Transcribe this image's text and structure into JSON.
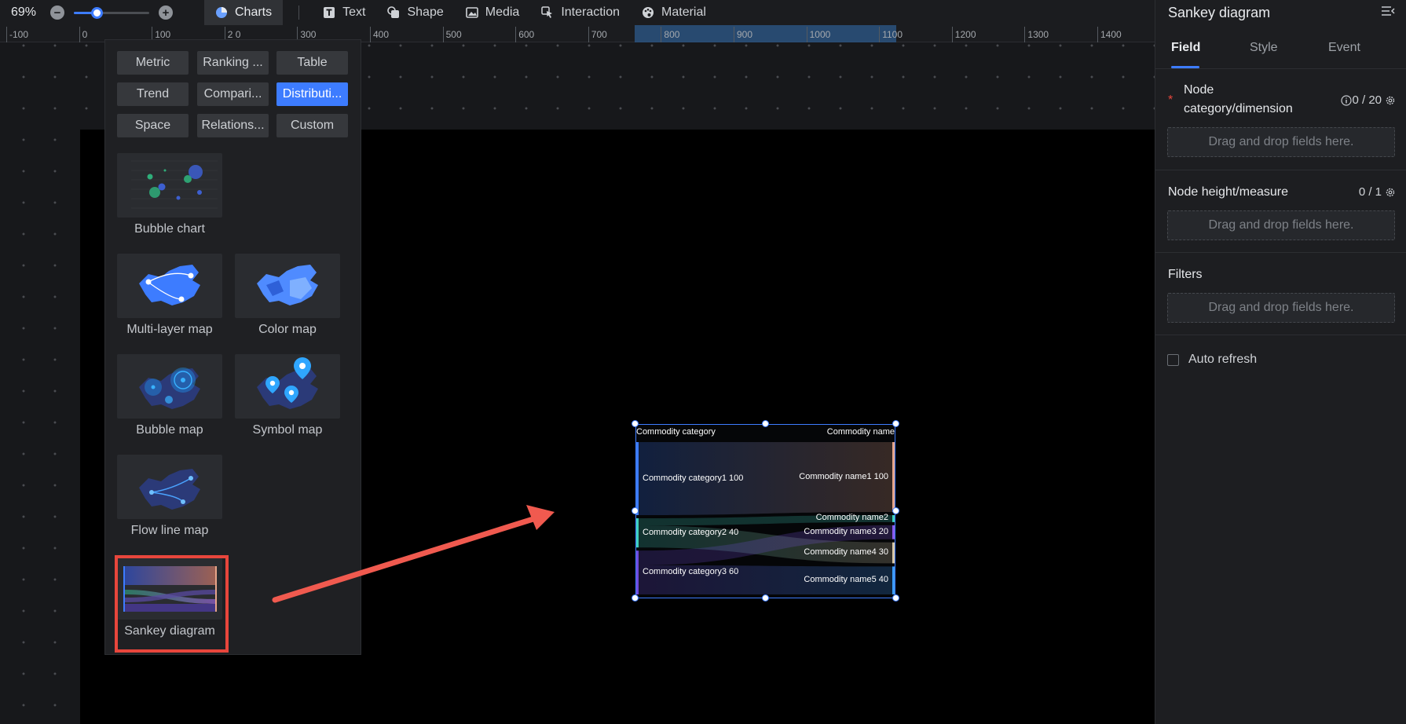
{
  "toolbar": {
    "zoom": "69%",
    "zoom_level_fraction": 0.3,
    "tools": [
      {
        "label": "Charts",
        "icon": "pie-chart-icon",
        "active": true
      },
      {
        "label": "Text",
        "icon": "text-icon"
      },
      {
        "label": "Shape",
        "icon": "shape-icon"
      },
      {
        "label": "Media",
        "icon": "image-icon"
      },
      {
        "label": "Interaction",
        "icon": "pointer-icon"
      },
      {
        "label": "Material",
        "icon": "palette-icon"
      }
    ]
  },
  "ruler": {
    "labels": [
      "-100",
      "0",
      "100",
      "2 0",
      "300",
      "400",
      "500",
      "600",
      "700",
      "800",
      "900",
      "1000",
      "1100",
      "1200",
      "1300",
      "1400"
    ]
  },
  "picker": {
    "categories": [
      "Metric",
      "Ranking ...",
      "Table",
      "Trend",
      "Compari...",
      "Distributi...",
      "Space",
      "Relations...",
      "Custom"
    ],
    "active_category": "Distributi...",
    "charts": [
      "Bubble chart",
      "Multi-layer map",
      "Color map",
      "Bubble map",
      "Symbol map",
      "Flow line map",
      "Sankey diagram"
    ],
    "selected_chart": "Sankey diagram"
  },
  "widget": {
    "left_header": "Commodity category",
    "right_header": "Commodity name",
    "left_nodes": [
      {
        "label": "Commodity category1 100",
        "value": 100,
        "color": "#3d7cff"
      },
      {
        "label": "Commodity category2 40",
        "value": 40,
        "color": "#3fd1c0"
      },
      {
        "label": "Commodity category3 60",
        "value": 60,
        "color": "#6e4ce0"
      }
    ],
    "right_nodes": [
      {
        "label": "Commodity name1 100",
        "value": 100,
        "color": "#e6a58a"
      },
      {
        "label": "Commodity name2",
        "value": 10,
        "color": "#3fd1c0"
      },
      {
        "label": "Commodity name3 20",
        "value": 20,
        "color": "#8a5cf0"
      },
      {
        "label": "Commodity name4 30",
        "value": 30,
        "color": "#d8c8a8"
      },
      {
        "label": "Commodity name5 40",
        "value": 40,
        "color": "#3d9cff"
      }
    ]
  },
  "panel": {
    "title": "Sankey diagram",
    "tabs": [
      "Field",
      "Style",
      "Event"
    ],
    "active_tab": "Field",
    "sections": {
      "node_category": {
        "label_line1": "Node",
        "label_line2": "category/dimension",
        "count": "0 / 20",
        "drop": "Drag and drop fields here."
      },
      "node_height": {
        "label": "Node height/measure",
        "count": "0 / 1",
        "drop": "Drag and drop fields here."
      },
      "filters": {
        "label": "Filters",
        "drop": "Drag and drop fields here."
      }
    },
    "auto_refresh": "Auto refresh"
  },
  "colors": {
    "accent": "#3d7cff",
    "highlight": "#e8463c",
    "arrow": "#f05a4f"
  }
}
